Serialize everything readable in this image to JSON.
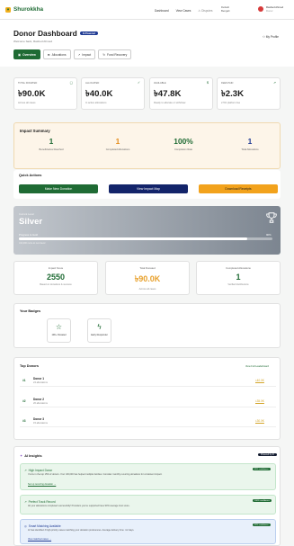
{
  "brand": {
    "name": "Shurokkha"
  },
  "nav": {
    "items": [
      "Dashboard",
      "View Cases",
      "Disputes"
    ]
  },
  "lang": {
    "label": "Default",
    "sub": "Bengali"
  },
  "user": {
    "name": "Rashed Ahmed",
    "role": "Donor"
  },
  "header": {
    "title": "Donor Dashboard",
    "badge": "AI Powered",
    "welcome": "Welcome back, Rashed Ahmed",
    "profile": "My Profile",
    "tabs": [
      "Overview",
      "Allocations",
      "Impact",
      "Fund Recovery"
    ]
  },
  "stats": [
    {
      "label": "Total Donated",
      "value": "৳90.0K",
      "sub": "Across all cases"
    },
    {
      "label": "Allocated",
      "value": "৳40.0K",
      "sub": "In active allocations"
    },
    {
      "label": "Available",
      "value": "৳47.8K",
      "sub": "Ready to allocate or withdraw"
    },
    {
      "label": "Fees Paid",
      "value": "৳2.3K",
      "sub": "2.5% platform fee"
    }
  ],
  "impact": {
    "title": "Impact Summary",
    "items": [
      {
        "value": "1",
        "label": "Beneficiaries Reached",
        "color": "#1f6b34"
      },
      {
        "value": "1",
        "label": "Completed Allocations",
        "color": "#e48c1c"
      },
      {
        "value": "100%",
        "label": "Completion Rate",
        "color": "#1f6b34"
      },
      {
        "value": "1",
        "label": "Total Allocations",
        "color": "#1f3a93"
      }
    ]
  },
  "quick_actions": {
    "title": "Quick Actions",
    "buttons": [
      {
        "label": "Make New Donation",
        "color": "#1f6b34"
      },
      {
        "label": "View Impact Map",
        "color": "#13246a"
      },
      {
        "label": "Download Receipts",
        "color": "#f2a21c"
      }
    ]
  },
  "level": {
    "label": "Current Level",
    "value": "Silver",
    "progress_label": "Progress to Gold",
    "percent_text": "90%",
    "progress": 0.9,
    "hint": "৳10,000 more to next level"
  },
  "metrics": [
    {
      "label": "Impact Score",
      "value": "2550",
      "sub": "Based on donations & success",
      "color": "#1f6b34"
    },
    {
      "label": "Total Donated",
      "value": "৳90.0K",
      "sub": "Across all cases",
      "color": "#e8a02b"
    },
    {
      "label": "Completed Allocations",
      "value": "1",
      "sub": "Verified distributions",
      "color": "#1f6b34"
    }
  ],
  "badges": {
    "title": "Your Badges",
    "items": [
      {
        "label": "10K+ Donated"
      },
      {
        "label": "Early Responder"
      }
    ]
  },
  "top_donors": {
    "title": "Top Donors",
    "link": "View Full Leaderboard",
    "rows": [
      {
        "rank": "#1",
        "name": "Donor 1",
        "meta": "24 allocations",
        "amount": "৳40.0K"
      },
      {
        "rank": "#2",
        "name": "Donor 2",
        "meta": "20 allocations",
        "amount": "৳35.0K"
      },
      {
        "rank": "#3",
        "name": "Donor 3",
        "meta": "15 allocations",
        "amount": "৳30.0K"
      }
    ]
  },
  "ai": {
    "title": "AI Insights",
    "pill": "Powered by AI",
    "boxes": [
      {
        "title": "High Impact Donor",
        "body": "You're in the top 15% of donors. Your ৳90,000 has helped multiple families. Consider monthly recurring donations for consistent impact.",
        "link": "Set up recurring donation →",
        "conf": "85% confidence",
        "bg": "#eaf6ec",
        "border": "#c4e6cb",
        "color": "#1f6b34"
      },
      {
        "title": "Perfect Track Record",
        "body": "All your allocations completed successfully! Providers you've supported have 90% average trust score.",
        "link": "",
        "conf": "100% confidence",
        "bg": "#eaf6ec",
        "border": "#c4e6cb",
        "color": "#1f6b34"
      },
      {
        "title": "Smart Matching Available",
        "body": "AI has identified 3 high-priority cases matching your donation preferences. Average delivery time: 4.2 days.",
        "link": "View matched cases →",
        "conf": "92% confidence",
        "bg": "#e8f0fb",
        "border": "#bcd0ef",
        "color": "#1f3a93"
      }
    ]
  }
}
